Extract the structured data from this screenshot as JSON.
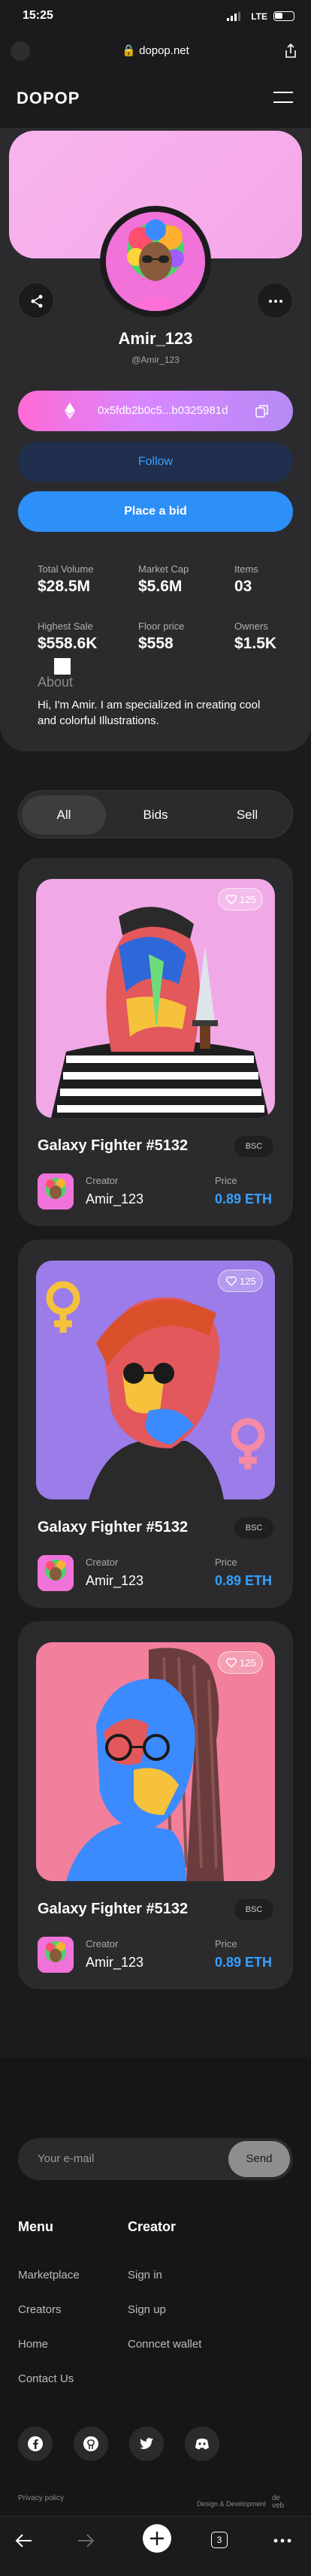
{
  "status": {
    "time": "15:25",
    "network": "LTE"
  },
  "browser": {
    "url": "dopop.net",
    "tab_count": "3"
  },
  "header": {
    "logo": "DOPOP"
  },
  "profile": {
    "username": "Amir_123",
    "handle": "@Amir_123",
    "wallet_address": "0x5fdb2b0c5...b0325981d",
    "follow_label": "Follow",
    "bid_label": "Place a bid",
    "stats": [
      {
        "label": "Total Volume",
        "value": "$28.5M"
      },
      {
        "label": "Market Cap",
        "value": "$5.6M"
      },
      {
        "label": "Items",
        "value": "03"
      },
      {
        "label": "Highest Sale",
        "value": "$558.6K"
      },
      {
        "label": "Floor price",
        "value": "$558"
      },
      {
        "label": "Owners",
        "value": "$1.5K"
      }
    ],
    "about_title": "About",
    "about_text": "Hi, I'm Amir. I am specialized in creating cool and colorful Illustrations."
  },
  "tabs": [
    {
      "label": "All",
      "active": true
    },
    {
      "label": "Bids",
      "active": false
    },
    {
      "label": "Sell",
      "active": false
    }
  ],
  "cards": [
    {
      "title": "Galaxy Fighter #5132",
      "chain": "BSC",
      "likes": "125",
      "creator_label": "Creator",
      "creator": "Amir_123",
      "price_label": "Price",
      "price": "0.89 ETH",
      "bg": "#f0a9e6"
    },
    {
      "title": "Galaxy Fighter #5132",
      "chain": "BSC",
      "likes": "125",
      "creator_label": "Creator",
      "creator": "Amir_123",
      "price_label": "Price",
      "price": "0.89 ETH",
      "bg": "#9b7ce8"
    },
    {
      "title": "Galaxy Fighter #5132",
      "chain": "BSC",
      "likes": "125",
      "creator_label": "Creator",
      "creator": "Amir_123",
      "price_label": "Price",
      "price": "0.89 ETH",
      "bg": "#f27f9c"
    }
  ],
  "footer": {
    "email_placeholder": "Your e-mail",
    "send_label": "Send",
    "menu_title": "Menu",
    "menu_links": [
      "Marketplace",
      "Creators",
      "Home",
      "Contact Us"
    ],
    "creator_title": "Creator",
    "creator_links": [
      "Sign in",
      "Sign up",
      "Conncet wallet"
    ],
    "privacy": "Privacy policy",
    "credit": "Design & Development",
    "social_icons": [
      "facebook-icon",
      "github-icon",
      "twitter-icon",
      "discord-icon"
    ]
  },
  "colors": {
    "accent": "#2d8ff8",
    "price": "#37a0ff",
    "background": "#1b1b1d",
    "card": "#2b2b2e"
  }
}
